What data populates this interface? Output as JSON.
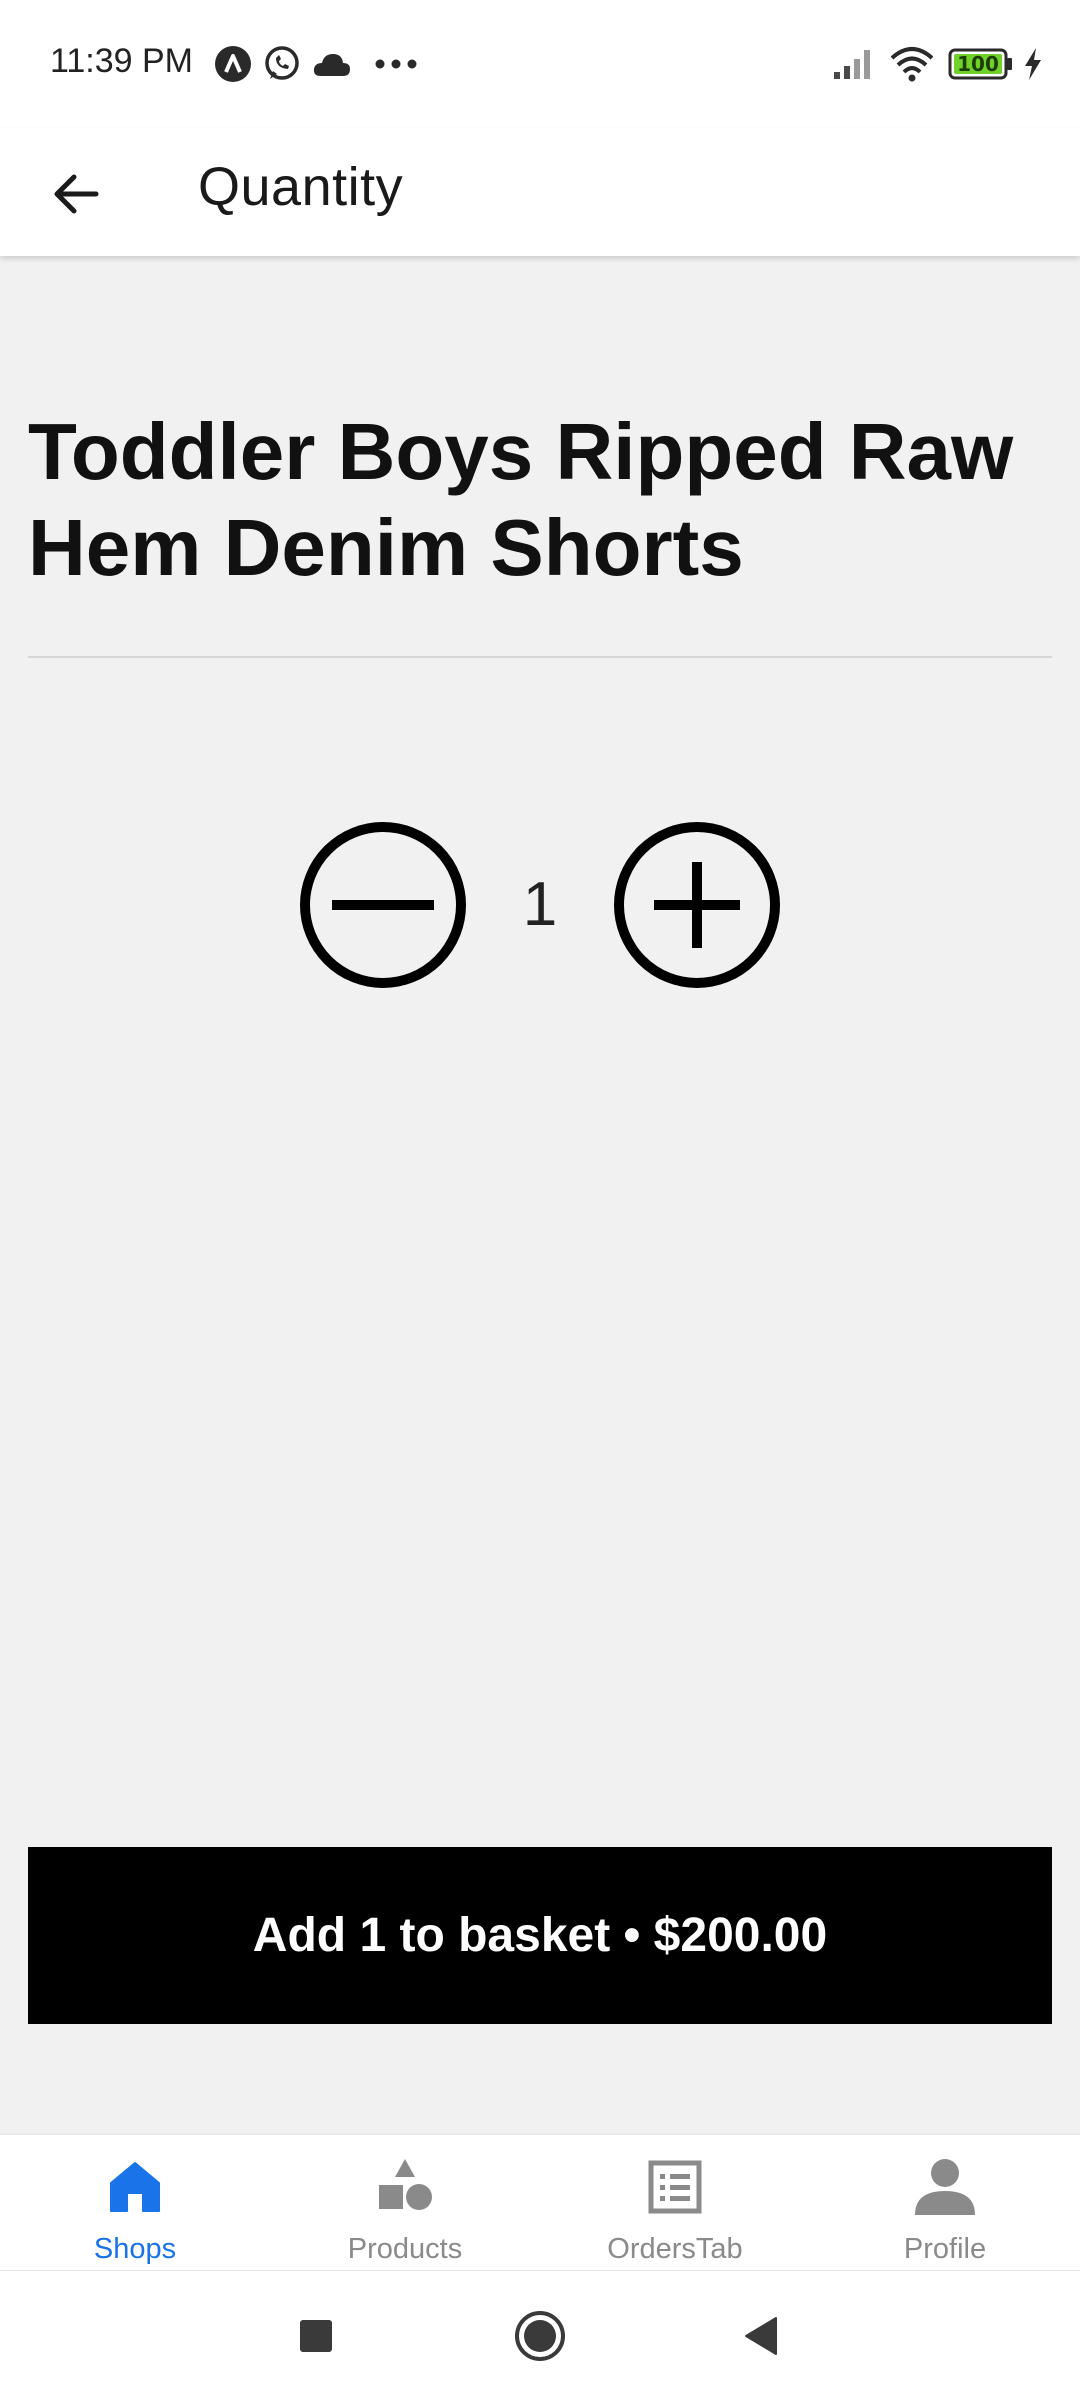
{
  "status_bar": {
    "time": "11:39 PM",
    "left_icons": [
      "app-a-icon",
      "whatsapp-icon",
      "cloud-icon",
      "more-dots-icon"
    ],
    "right_icons": [
      "signal-icon",
      "wifi-icon",
      "battery-icon",
      "charging-icon"
    ],
    "battery_level": "100"
  },
  "app_bar": {
    "back_icon": "arrow-left-icon",
    "title": "Quantity"
  },
  "product": {
    "title": "Toddler Boys Ripped Raw Hem Denim Shorts"
  },
  "quantity": {
    "value": "1",
    "decrement_icon": "minus-circle-icon",
    "increment_icon": "plus-circle-icon"
  },
  "add_button": {
    "label": "Add 1 to basket • $200.00"
  },
  "bottom_nav": {
    "items": [
      {
        "label": "Shops",
        "icon": "home-icon",
        "active": true
      },
      {
        "label": "Products",
        "icon": "shapes-icon",
        "active": false
      },
      {
        "label": "OrdersTab",
        "icon": "list-icon",
        "active": false
      },
      {
        "label": "Profile",
        "icon": "person-icon",
        "active": false
      }
    ],
    "active_color": "#1a73e8",
    "inactive_color": "#8a8a8a"
  },
  "system_nav": {
    "icons": [
      "recents-square-icon",
      "home-circle-icon",
      "back-triangle-icon"
    ]
  },
  "colors": {
    "background": "#f1f1f1",
    "button_background": "#000000",
    "button_text": "#ffffff",
    "accent": "#1a73e8",
    "battery_fill": "#6fd12a"
  }
}
